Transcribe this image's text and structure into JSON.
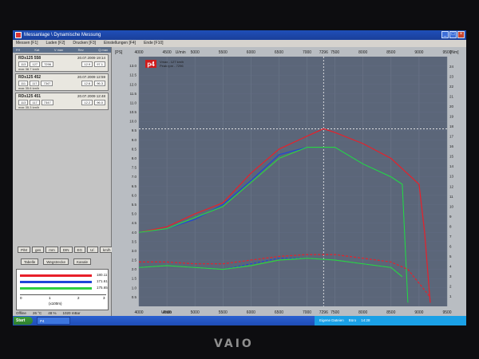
{
  "window": {
    "title": "Messanlage \\ Dynamische Messung"
  },
  "menu": [
    "Messen [F1]",
    "Laden [F2]",
    "Drucken [F3]",
    "Einstellungen [F4]",
    "Ende [F10]"
  ],
  "panel": {
    "header": [
      "P/f",
      "Kat",
      "V max",
      "Rev",
      "Q max"
    ],
    "runs": [
      {
        "name": "RDs125 558",
        "date": "20.07.2009 19:14",
        "values": [
          "113",
          "127",
          "7296"
        ],
        "values2": [
          "12.9",
          "97.1"
        ],
        "info": "max 38.7 km/h"
      },
      {
        "name": "RDs125 452",
        "date": "20.07.2009 12:59",
        "values": [
          "111",
          "117",
          "7347"
        ],
        "values2": [
          "12.6",
          "96.3"
        ],
        "info": "max 35.6 km/h"
      },
      {
        "name": "RDs125 451",
        "date": "20.07.2009 12:48",
        "values": [
          "113",
          "117",
          "7347"
        ],
        "values2": [
          "12.2",
          "96.0"
        ],
        "info": "max 35.3 km/h"
      }
    ],
    "buttons_row1": [
      "P/M",
      "ges",
      "mm",
      "DIN",
      "EG",
      "U/.",
      "km/h"
    ],
    "buttons_row2": [
      "Tabelle",
      "Wegstrecke",
      "Kanale"
    ],
    "legend": [
      {
        "color": "#e8202a",
        "value": "180.11"
      },
      {
        "color": "#1f46d8",
        "value": "171.61"
      },
      {
        "color": "#2fd140",
        "value": "175.65"
      }
    ],
    "mini_axis": [
      "0",
      "1",
      "2",
      "3"
    ],
    "mini_axis_label": "(x100m)",
    "status": [
      "Offline",
      "26 °C",
      "48 %",
      "1020 mBar"
    ]
  },
  "chart_data": {
    "type": "line",
    "logo": "p4",
    "legend_small": [
      "Vmax - 127 km/h",
      "Peak rpm - 7296"
    ],
    "xlabel": "U/min",
    "top_axis_label": "U/min",
    "left_axis_label": "[PS]",
    "right_axis_label": "[Nm]",
    "xlim": [
      4000,
      9500
    ],
    "x_ticks": [
      4000,
      4500,
      5000,
      5500,
      6000,
      6500,
      7000,
      7296,
      7500,
      8000,
      8500,
      9000,
      9500
    ],
    "ylim_left": [
      0,
      13.5
    ],
    "y_ticks_left": [
      0.5,
      1.0,
      1.5,
      2.0,
      2.5,
      3.0,
      3.5,
      4.0,
      4.5,
      5.0,
      5.5,
      6.0,
      6.5,
      7.0,
      7.5,
      8.0,
      8.5,
      9.0,
      9.5,
      10.0,
      10.5,
      11.0,
      11.5,
      12.0,
      12.5,
      13.0
    ],
    "y_ticks_right": [
      1,
      2,
      3,
      4,
      5,
      6,
      7,
      8,
      9,
      10,
      11,
      12,
      13,
      14,
      15,
      16,
      17,
      18,
      19,
      20,
      21,
      22,
      23,
      24
    ],
    "cursor": {
      "rpm": 7296,
      "value": 9.6
    },
    "series": [
      {
        "name": "RDs125 558",
        "color": "#e8202a",
        "dashed": false,
        "x": [
          4000,
          4500,
          5000,
          5500,
          6000,
          6500,
          7000,
          7296,
          7500,
          8000,
          8500,
          9000,
          9100,
          9200
        ],
        "y": [
          4.0,
          4.3,
          5.0,
          5.6,
          7.2,
          8.5,
          9.2,
          9.6,
          9.4,
          8.8,
          8.0,
          6.6,
          4.0,
          0.2
        ]
      },
      {
        "name": "RDs125 452",
        "color": "#1f46d8",
        "dashed": false,
        "x": [
          4000,
          4500,
          5000,
          5500,
          6000,
          6500,
          7000,
          7500,
          8000,
          8500,
          8700,
          8800
        ],
        "y": [
          4.0,
          4.2,
          4.7,
          5.5,
          6.8,
          8.2,
          8.6,
          8.6,
          7.7,
          7.0,
          6.6,
          0.2
        ]
      },
      {
        "name": "RDs125 451",
        "color": "#2fd140",
        "dashed": false,
        "x": [
          4000,
          4500,
          5000,
          5500,
          6000,
          6500,
          7000,
          7500,
          8000,
          8500,
          8700,
          8800
        ],
        "y": [
          4.0,
          4.2,
          4.8,
          5.4,
          6.7,
          8.0,
          8.6,
          8.6,
          7.7,
          7.0,
          6.6,
          0.2
        ]
      },
      {
        "name": "RDs125 558 torque",
        "color": "#e8202a",
        "dashed": true,
        "x": [
          4000,
          4500,
          5000,
          5500,
          6000,
          6500,
          7000,
          7500,
          8000,
          8500,
          8800,
          9200
        ],
        "y": [
          2.4,
          2.4,
          2.3,
          2.3,
          2.5,
          2.7,
          2.8,
          2.8,
          2.6,
          2.4,
          2.0,
          0.5
        ]
      },
      {
        "name": "RDs125 452 torque",
        "color": "#1f46d8",
        "dashed": true,
        "x": [
          4000,
          4500,
          5000,
          5500,
          6000,
          6500,
          7000,
          7500,
          8000,
          8500,
          8700
        ],
        "y": [
          2.1,
          2.2,
          2.1,
          2.0,
          2.3,
          2.6,
          2.6,
          2.5,
          2.3,
          2.1,
          1.6
        ]
      },
      {
        "name": "RDs125 451 torque",
        "color": "#2fd140",
        "dashed": false,
        "x": [
          4000,
          4500,
          5000,
          5500,
          6000,
          6500,
          7000,
          7500,
          8000,
          8500,
          8700
        ],
        "y": [
          2.1,
          2.2,
          2.1,
          2.0,
          2.2,
          2.5,
          2.6,
          2.5,
          2.3,
          2.1,
          1.6
        ]
      }
    ]
  },
  "taskbar": {
    "start": "Start",
    "app": "P4",
    "tray": [
      "Eigene Dateien",
      "Büro",
      "14:28"
    ]
  },
  "brand": "VAIO"
}
